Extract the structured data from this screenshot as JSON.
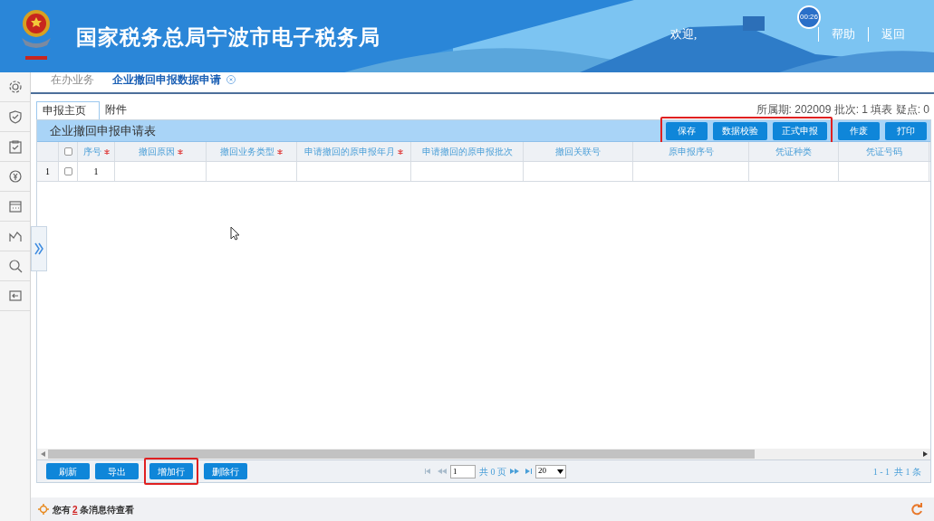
{
  "header": {
    "title": "国家税务总局宁波市电子税务局",
    "timer": "00:26",
    "welcome": "欢迎,",
    "links": [
      "帮助",
      "返回"
    ]
  },
  "tabs": [
    {
      "label": "在办业务",
      "selected": false,
      "closable": false
    },
    {
      "label": "企业撤回申报数据申请",
      "selected": true,
      "closable": true
    }
  ],
  "sub_tabs": [
    {
      "label": "申报主页",
      "selected": true
    },
    {
      "label": "附件",
      "selected": false
    }
  ],
  "period_info": "所属期: 202009 批次: 1 填表 疑点: 0",
  "form_title": "企业撤回申报申请表",
  "top_buttons": [
    {
      "label": "保存",
      "highlighted": true
    },
    {
      "label": "数据校验",
      "highlighted": true
    },
    {
      "label": "正式申报",
      "highlighted": true
    },
    {
      "label": "作废",
      "highlighted": false
    },
    {
      "label": "打印",
      "highlighted": false
    }
  ],
  "table": {
    "select_all_checked": false,
    "columns": [
      {
        "label": "序号",
        "required": true
      },
      {
        "label": "撤回原因",
        "required": true
      },
      {
        "label": "撤回业务类型",
        "required": true
      },
      {
        "label": "申请撤回的原申报年月",
        "required": true
      },
      {
        "label": "申请撤回的原申报批次",
        "required": false
      },
      {
        "label": "撤回关联号",
        "required": false
      },
      {
        "label": "原申报序号",
        "required": false
      },
      {
        "label": "凭证种类",
        "required": false
      },
      {
        "label": "凭证号码",
        "required": false
      }
    ],
    "rows": [
      {
        "row_number": "1",
        "checked": false,
        "cells": [
          "1",
          "",
          "",
          "",
          "",
          "",
          "",
          "",
          ""
        ]
      }
    ]
  },
  "bottom_buttons": [
    {
      "label": "刷新",
      "highlighted": false
    },
    {
      "label": "导出",
      "highlighted": false
    },
    {
      "label": "增加行",
      "highlighted": true
    },
    {
      "label": "删除行",
      "highlighted": false
    }
  ],
  "pager": {
    "page": "1",
    "total_pages": "共 0 页",
    "page_size": "20",
    "summary": "1 - 1  共 1 条"
  },
  "status_bar": {
    "prefix": "您有",
    "count": "2",
    "suffix": "条消息待查看"
  }
}
